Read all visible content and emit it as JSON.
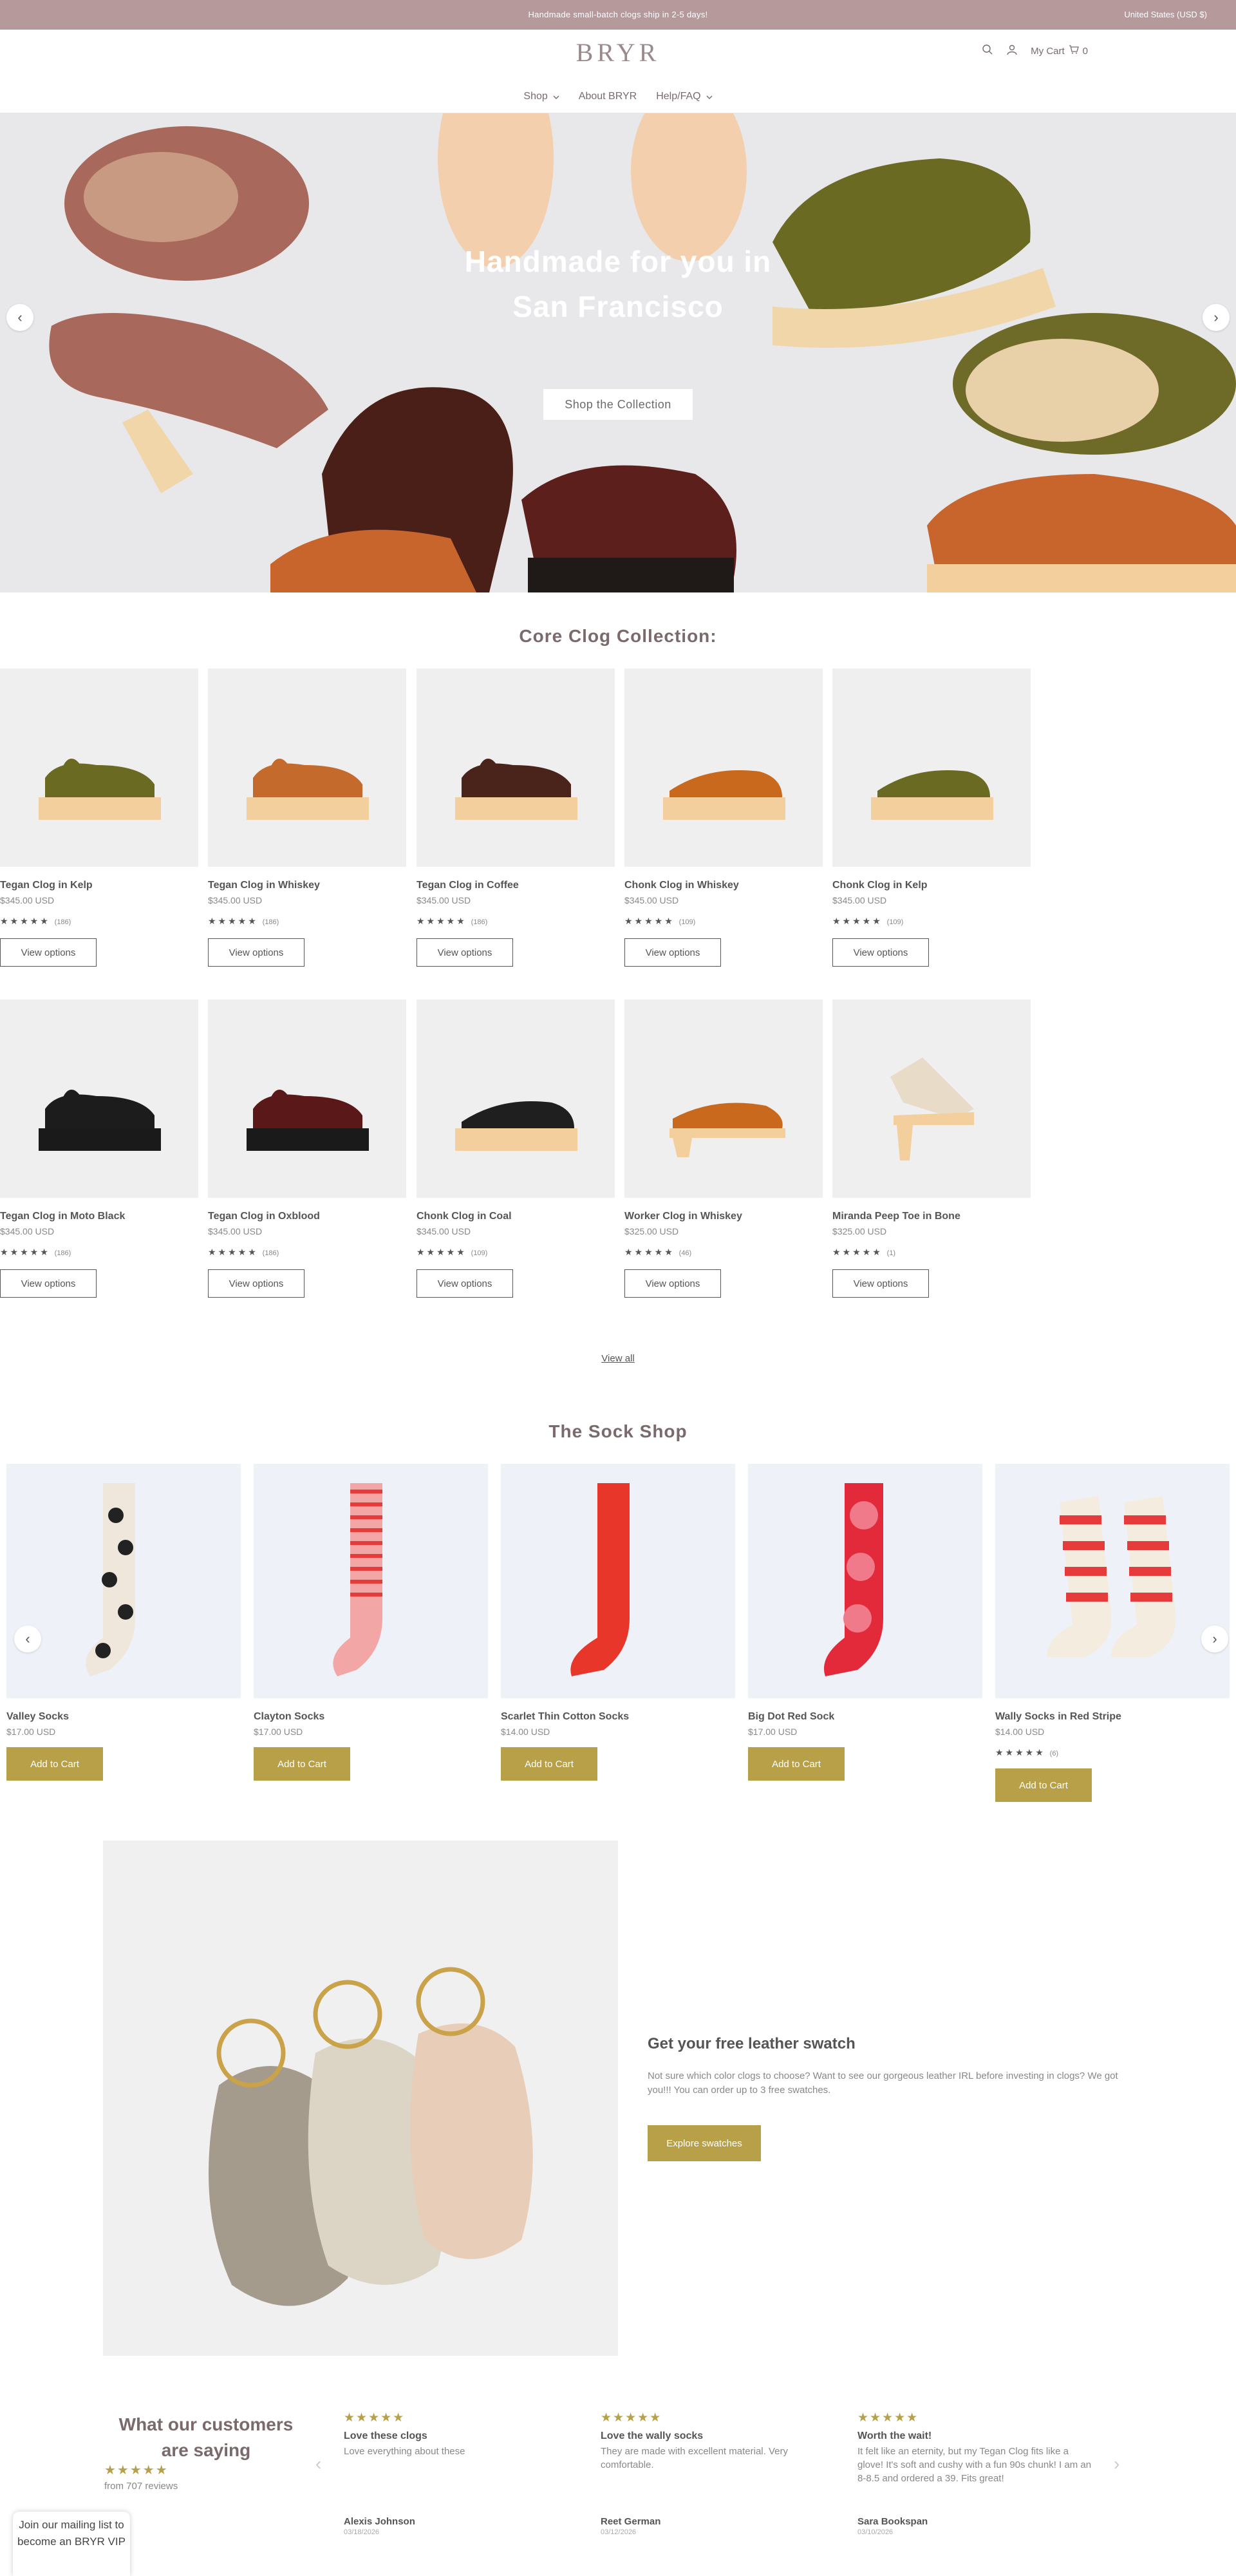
{
  "announcement": {
    "message": "Handmade small-batch clogs ship in 2-5 days!",
    "currency": "United States (USD $)"
  },
  "header": {
    "logo": "BRYR",
    "cart_label": "My Cart",
    "cart_count": "0",
    "icons": [
      "search-icon",
      "account-icon",
      "cart-icon"
    ]
  },
  "nav": [
    {
      "label": "Shop",
      "dropdown": true
    },
    {
      "label": "About BRYR",
      "dropdown": false
    },
    {
      "label": "Help/FAQ",
      "dropdown": true
    }
  ],
  "hero": {
    "title": "Handmade for you in San Francisco",
    "button": "Shop the Collection"
  },
  "core": {
    "title": "Core Clog Collection:",
    "button_label": "View options",
    "products": [
      {
        "name": "Tegan Clog in Kelp",
        "price": "$345.00 USD",
        "stars": "★★★★★",
        "count": "(186)",
        "color": "#6b6a22",
        "sole": "#f2cf9c",
        "type": "tegan"
      },
      {
        "name": "Tegan Clog in Whiskey",
        "price": "$345.00 USD",
        "stars": "★★★★★",
        "count": "(186)",
        "color": "#c46a2c",
        "sole": "#f2cf9c",
        "type": "tegan"
      },
      {
        "name": "Tegan Clog in Coffee",
        "price": "$345.00 USD",
        "stars": "★★★★★",
        "count": "(186)",
        "color": "#4a231b",
        "sole": "#f2cf9c",
        "type": "tegan"
      },
      {
        "name": "Chonk Clog in Whiskey",
        "price": "$345.00 USD",
        "stars": "★★★★★",
        "count": "(109)",
        "color": "#c9691e",
        "sole": "#f2cf9c",
        "type": "chonk"
      },
      {
        "name": "Chonk Clog in Kelp",
        "price": "$345.00 USD",
        "stars": "★★★★★",
        "count": "(109)",
        "color": "#6b6a22",
        "sole": "#f2cf9c",
        "type": "chonk"
      },
      {
        "name": "Tegan Clog in Moto Black",
        "price": "$345.00 USD",
        "stars": "★★★★★",
        "count": "(186)",
        "color": "#1c1c1c",
        "sole": "#1a1a1a",
        "type": "tegan"
      },
      {
        "name": "Tegan Clog in Oxblood",
        "price": "$345.00 USD",
        "stars": "★★★★★",
        "count": "(186)",
        "color": "#5a1818",
        "sole": "#1a1a1a",
        "type": "tegan"
      },
      {
        "name": "Chonk Clog in Coal",
        "price": "$345.00 USD",
        "stars": "★★★★★",
        "count": "(109)",
        "color": "#1f1f1f",
        "sole": "#f2cf9c",
        "type": "chonk"
      },
      {
        "name": "Worker Clog in Whiskey",
        "price": "$325.00 USD",
        "stars": "★★★★★",
        "count": "(46)",
        "color": "#c9691e",
        "sole": "#f2cf9c",
        "type": "worker"
      },
      {
        "name": "Miranda Peep Toe in Bone",
        "price": "$325.00 USD",
        "stars": "★★★★★",
        "count": "(1)",
        "color": "#e8dcc8",
        "sole": "#f2cf9c",
        "type": "miranda"
      }
    ],
    "view_all": "View all"
  },
  "socks": {
    "title": "The Sock Shop",
    "button_label": "Add to Cart",
    "items": [
      {
        "name": "Valley Socks",
        "price": "$17.00 USD",
        "stars": "",
        "count": ""
      },
      {
        "name": "Clayton Socks",
        "price": "$17.00 USD",
        "stars": "",
        "count": ""
      },
      {
        "name": "Scarlet Thin Cotton Socks",
        "price": "$14.00 USD",
        "stars": "",
        "count": ""
      },
      {
        "name": "Big Dot Red Sock",
        "price": "$17.00 USD",
        "stars": "",
        "count": ""
      },
      {
        "name": "Wally Socks in Red Stripe",
        "price": "$14.00 USD",
        "stars": "★★★★★",
        "count": "(6)"
      }
    ]
  },
  "swatch": {
    "title": "Get your free leather swatch",
    "text": "Not sure which color clogs to choose? Want to see our gorgeous leather IRL before investing in clogs? We got you!!! You can order up to 3 free swatches.",
    "button": "Explore swatches"
  },
  "reviews": {
    "title": "What our customers are saying",
    "stars": "★★★★★",
    "count": "from 707 reviews",
    "items": [
      {
        "stars": "★★★★★",
        "title": "Love these clogs",
        "body": "Love everything about these",
        "name": "Alexis Johnson",
        "date": "03/18/2026"
      },
      {
        "stars": "★★★★★",
        "title": "Love the wally socks",
        "body": "They are made with excellent material. Very comfortable.",
        "name": "Reet German",
        "date": "03/12/2026"
      },
      {
        "stars": "★★★★★",
        "title": "Worth the wait!",
        "body": "It felt like an eternity, but my Tegan Clog fits like a glove! It's soft and cushy with a fun 90s chunk! I am an 8-8.5 and ordered a 39. Fits great!",
        "name": "Sara Bookspan",
        "date": "03/10/2026"
      }
    ]
  },
  "mailing": "Join our mailing list to become an BRYR VIP"
}
